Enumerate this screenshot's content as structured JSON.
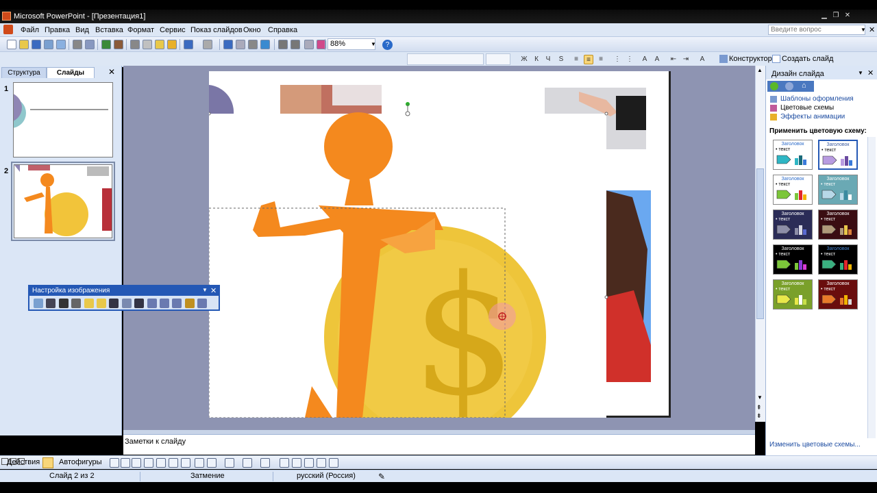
{
  "window": {
    "title": "Microsoft PowerPoint - [Презентация1]"
  },
  "menu": [
    "Файл",
    "Правка",
    "Вид",
    "Вставка",
    "Формат",
    "Сервис",
    "Показ слайдов",
    "Окно",
    "Справка"
  ],
  "ask_placeholder": "Введите вопрос",
  "standard_toolbar": {
    "zoom": "88%"
  },
  "format_toolbar": {
    "designer_label": "Конструктор",
    "new_slide_label": "Создать слайд"
  },
  "left_panel": {
    "tabs": [
      "Структура",
      "Слайды"
    ],
    "slide_numbers": [
      "1",
      "2"
    ]
  },
  "picture_toolbar": {
    "title": "Настройка изображения"
  },
  "notes": {
    "placeholder": "Заметки к слайду"
  },
  "task_pane": {
    "title": "Дизайн слайда",
    "links": [
      "Шаблоны оформления",
      "Цветовые схемы",
      "Эффекты анимации"
    ],
    "apply_label": "Применить цветовую схему:",
    "scheme_title": "Заголовок",
    "scheme_bullet": "• текст",
    "schemes": [
      {
        "bg": "#ffffff",
        "title": "#2a6ac9",
        "text": "#000000",
        "shape": "#2fb6c4",
        "bars": [
          "#2fb6c4",
          "#1a6a7a",
          "#3a7ad9"
        ]
      },
      {
        "bg": "#ffffff",
        "title": "#3a5aa0",
        "text": "#000000",
        "shape": "#b89be0",
        "bars": [
          "#b89be0",
          "#6a4aa0",
          "#3a7ad9"
        ]
      },
      {
        "bg": "#ffffff",
        "title": "#2a6ac9",
        "text": "#000000",
        "shape": "#7cc63a",
        "bars": [
          "#7cc63a",
          "#e2262b",
          "#f0b400"
        ]
      },
      {
        "bg": "#6aa9b4",
        "title": "#ffffff",
        "text": "#ffffff",
        "shape": "#b8d8e8",
        "bars": [
          "#b8d8e8",
          "#3a8aa0",
          "#ffffff"
        ]
      },
      {
        "bg": "#2b2c57",
        "title": "#ffffff",
        "text": "#ffffff",
        "shape": "#8d8ea8",
        "bars": [
          "#8d8ea8",
          "#d9d9e6",
          "#5a6ad0"
        ]
      },
      {
        "bg": "#3a0d12",
        "title": "#ffffff",
        "text": "#ffffff",
        "shape": "#b09a7a",
        "bars": [
          "#b09a7a",
          "#e8c84a",
          "#d9803a"
        ]
      },
      {
        "bg": "#000000",
        "title": "#ffffff",
        "text": "#ffffff",
        "shape": "#7cc63a",
        "bars": [
          "#7cc63a",
          "#8a3ad9",
          "#d93ad9"
        ]
      },
      {
        "bg": "#000000",
        "title": "#4a8ad9",
        "text": "#ffffff",
        "shape": "#3ab080",
        "bars": [
          "#3ab080",
          "#e2262b",
          "#f0b400"
        ]
      },
      {
        "bg": "#7aa02a",
        "title": "#ffffff",
        "text": "#ffffff",
        "shape": "#e8e84a",
        "bars": [
          "#e8e84a",
          "#ffffff",
          "#c8e04a"
        ]
      },
      {
        "bg": "#6a0d0d",
        "title": "#ffffff",
        "text": "#ffffff",
        "shape": "#e87a2a",
        "bars": [
          "#e87a2a",
          "#f0b400",
          "#d9d9d9"
        ]
      }
    ],
    "footer_link": "Изменить цветовые схемы..."
  },
  "draw_toolbar": {
    "actions_label": "Действия",
    "autoshapes_label": "Автофигуры"
  },
  "status": {
    "slide": "Слайд 2 из 2",
    "design": "Затмение",
    "language": "русский (Россия)"
  }
}
